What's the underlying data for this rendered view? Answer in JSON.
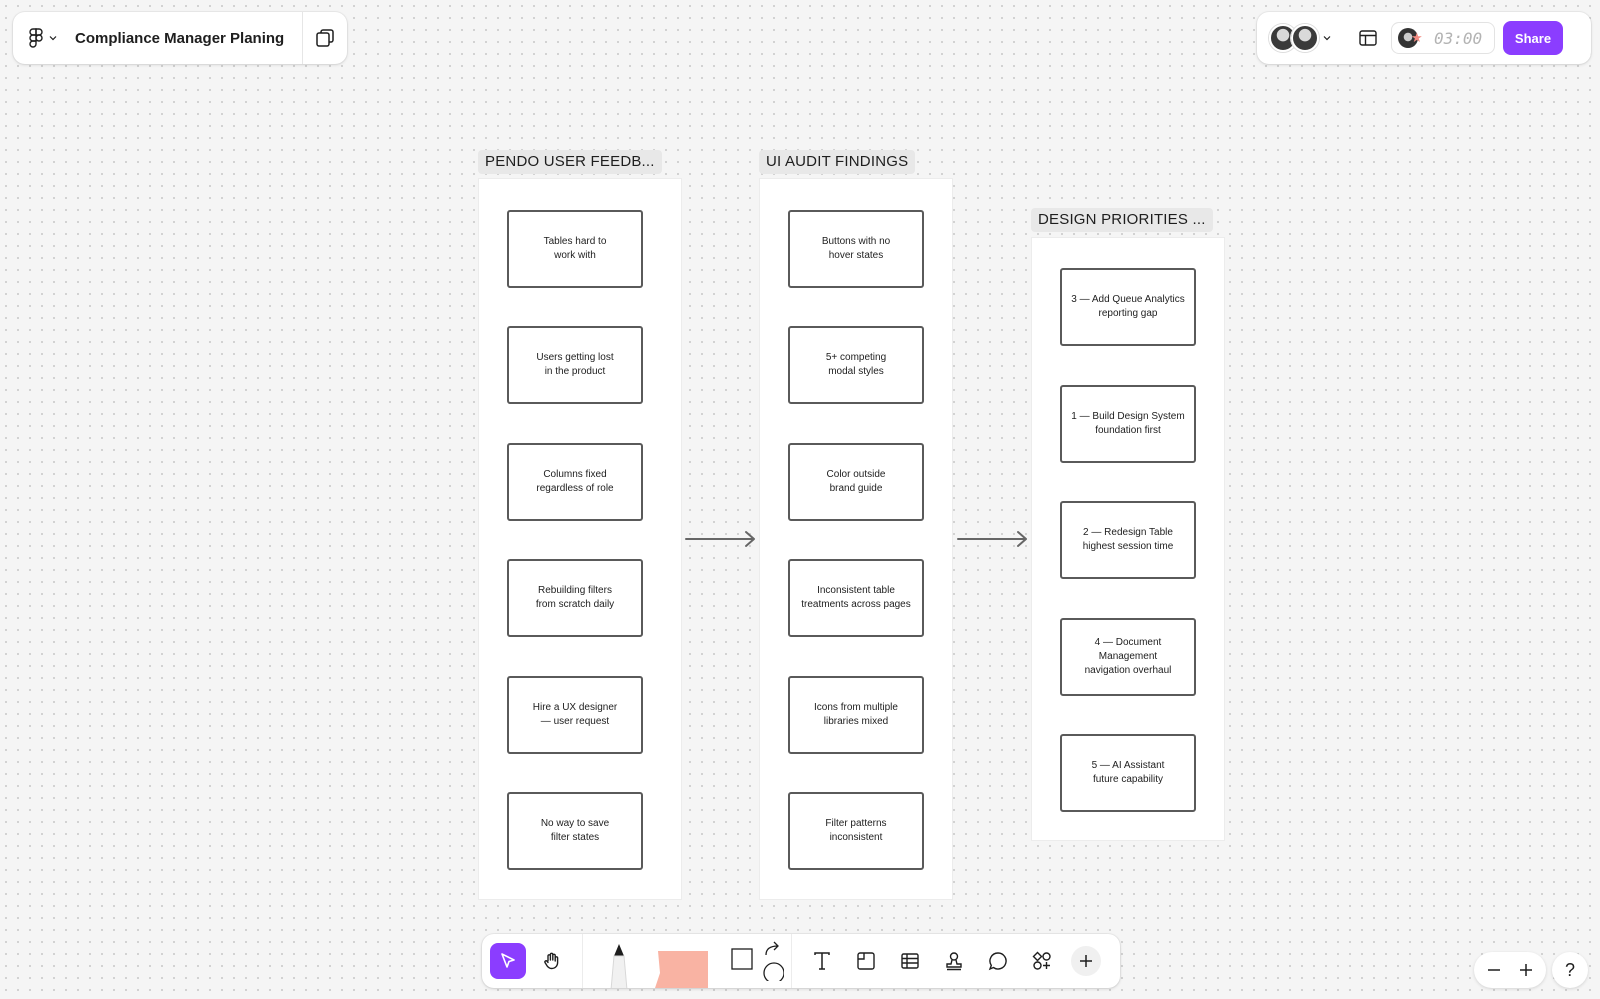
{
  "file": {
    "title": "Compliance Manager Planing"
  },
  "header": {
    "timer": "03:00",
    "share_label": "Share"
  },
  "sections": [
    {
      "label": "PENDO USER FEEDB...",
      "cards": [
        "Tables hard to\nwork with",
        "Users getting lost\nin the product",
        "Columns fixed\nregardless of role",
        "Rebuilding filters\nfrom scratch daily",
        "Hire a UX designer\n— user request",
        "No way to save\nfilter states"
      ]
    },
    {
      "label": "UI AUDIT FINDINGS",
      "cards": [
        "Buttons with no\nhover states",
        "5+ competing\nmodal styles",
        "Color outside\nbrand guide",
        "Inconsistent table\ntreatments across pages",
        "Icons from multiple\nlibraries mixed",
        "Filter patterns\ninconsistent"
      ]
    },
    {
      "label": "DESIGN PRIORITIES ...",
      "cards": [
        "3 — Add Queue Analytics\nreporting gap",
        "1 — Build Design System\nfoundation first",
        "2 — Redesign Table\nhighest session time",
        "4 — Document\nManagement\nnavigation overhaul",
        "5 — AI Assistant\nfuture capability"
      ]
    }
  ],
  "help": {
    "label": "?"
  },
  "colors": {
    "accent": "#8b3dff",
    "sticky": "#f9b3a3",
    "card_border": "#5a5a5a"
  }
}
